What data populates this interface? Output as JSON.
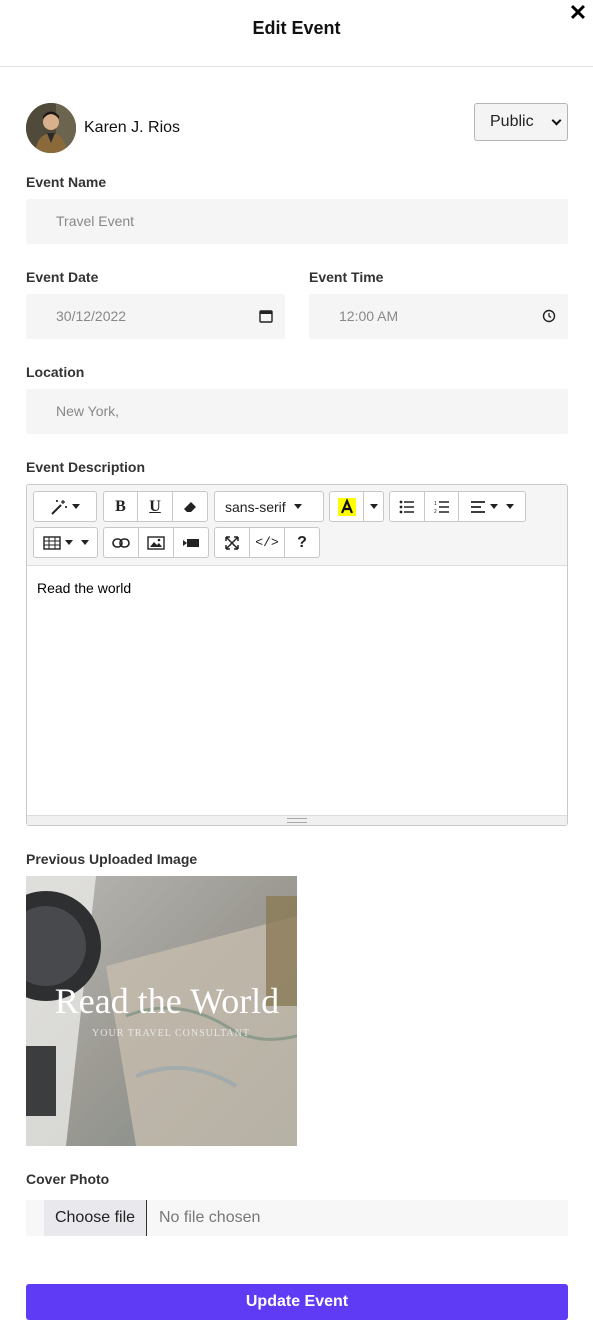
{
  "modal": {
    "title": "Edit Event",
    "close_label": "✕"
  },
  "user": {
    "name": "Karen J. Rios",
    "privacy": "Public"
  },
  "form": {
    "event_name": {
      "label": "Event Name",
      "value": "Travel Event"
    },
    "event_date": {
      "label": "Event Date",
      "value": "30/12/2022"
    },
    "event_time": {
      "label": "Event Time",
      "value": "12:00 AM"
    },
    "location": {
      "label": "Location",
      "value": "New York,"
    },
    "description": {
      "label": "Event Description",
      "content": "Read the world",
      "toolbar": {
        "font_family": "sans-serif",
        "help": "?",
        "code": "</>"
      }
    },
    "previous_image": {
      "label": "Previous Uploaded Image",
      "title_text": "Read the World",
      "subtitle_text": "YOUR TRAVEL CONSULTANT"
    },
    "cover_photo": {
      "label": "Cover Photo",
      "button": "Choose file",
      "status": "No file chosen"
    },
    "submit": "Update Event"
  },
  "colors": {
    "primary": "#5f3bf6",
    "highlight": "#ffff00",
    "field_bg": "#f5f5f5"
  }
}
